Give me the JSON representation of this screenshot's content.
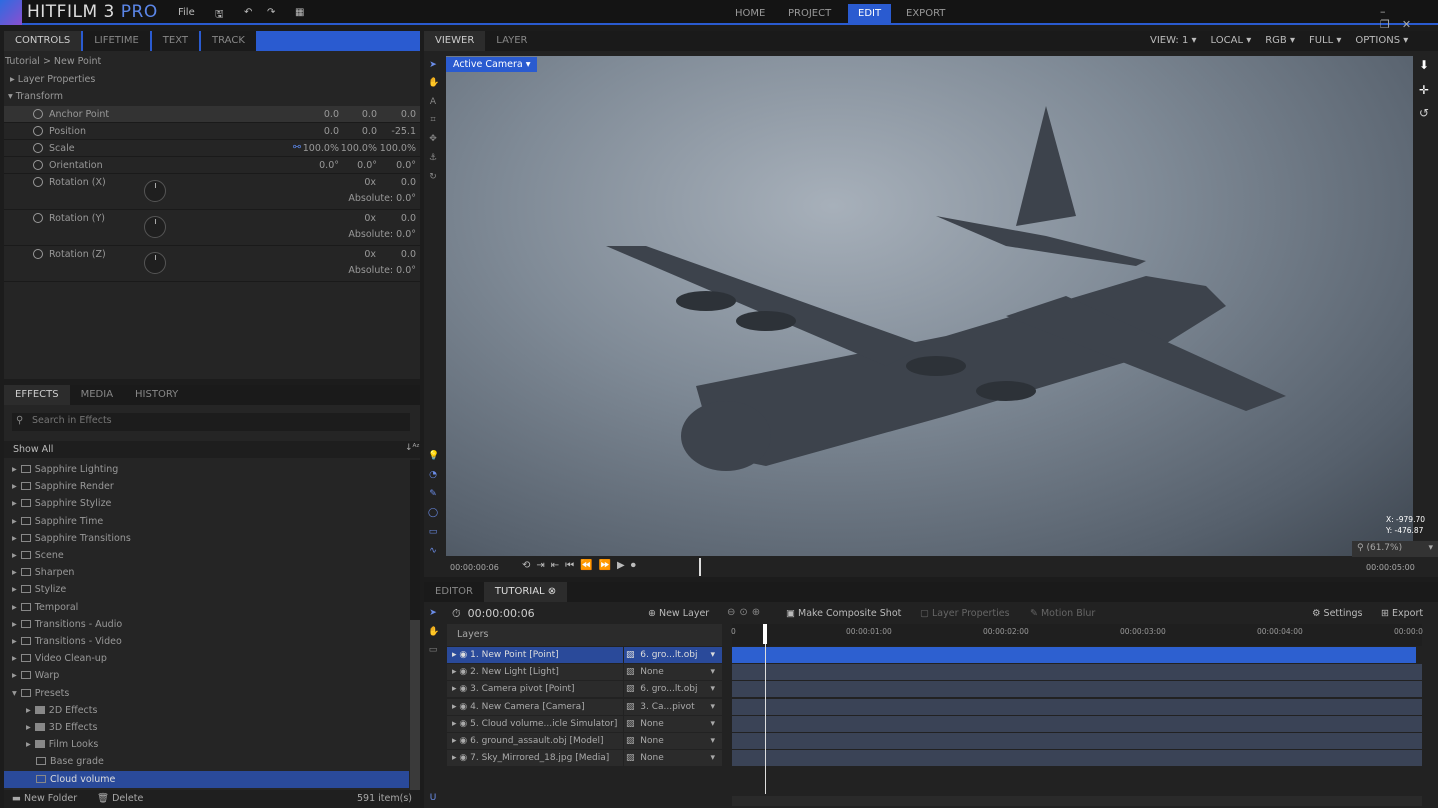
{
  "app": {
    "name": "HITFILM 3",
    "edition": "PRO",
    "menu_file": "File",
    "nav": [
      "HOME",
      "PROJECT",
      "EDIT",
      "EXPORT"
    ],
    "active_nav": "EDIT",
    "accent": "#2a5bd0"
  },
  "controls": {
    "tabs": [
      "CONTROLS",
      "LIFETIME",
      "TEXT",
      "TRACK"
    ],
    "breadcrumb": "Tutorial > New Point",
    "groups": [
      "Layer Properties",
      "Transform"
    ],
    "props": [
      {
        "name": "Anchor Point",
        "values": [
          "0.0",
          "0.0",
          "0.0"
        ]
      },
      {
        "name": "Position",
        "values": [
          "0.0",
          "0.0",
          "-25.1"
        ]
      },
      {
        "name": "Scale",
        "values": [
          "100.0%",
          "100.0%",
          "100.0%"
        ]
      },
      {
        "name": "Orientation",
        "values": [
          "0.0°",
          "0.0°",
          "0.0°"
        ]
      },
      {
        "name": "Rotation (X)",
        "values": [
          "0x",
          "0.0"
        ],
        "absolute": "Absolute: 0.0°"
      },
      {
        "name": "Rotation (Y)",
        "values": [
          "0x",
          "0.0"
        ],
        "absolute": "Absolute: 0.0°"
      },
      {
        "name": "Rotation (Z)",
        "values": [
          "0x",
          "0.0"
        ],
        "absolute": "Absolute: 0.0°"
      }
    ]
  },
  "effects": {
    "tabs": [
      "EFFECTS",
      "MEDIA",
      "HISTORY"
    ],
    "search_placeholder": "Search in Effects",
    "filter": "Show All",
    "items": [
      "Sapphire Lighting",
      "Sapphire Render",
      "Sapphire Stylize",
      "Sapphire Time",
      "Sapphire Transitions",
      "Scene",
      "Sharpen",
      "Stylize",
      "Temporal",
      "Transitions - Audio",
      "Transitions - Video",
      "Video Clean-up",
      "Warp",
      "Presets"
    ],
    "presets": [
      "2D Effects",
      "3D Effects",
      "Film Looks",
      "Base grade",
      "Cloud volume"
    ],
    "selected": "Cloud volume",
    "new_folder": "New Folder",
    "delete": "Delete",
    "count": "591 item(s)"
  },
  "viewer": {
    "tabs": [
      "VIEWER",
      "LAYER"
    ],
    "options": [
      "VIEW: 1",
      "LOCAL",
      "RGB",
      "FULL",
      "OPTIONS"
    ],
    "camera": "Active Camera",
    "coord_x": "X: -979.70",
    "coord_y": "Y: -476.87",
    "zoom": "(61.7%)",
    "time_start": "00:00:00:06",
    "time_end": "00:00:05:00"
  },
  "timeline": {
    "tabs": [
      "EDITOR",
      "TUTORIAL"
    ],
    "current_time": "00:00:00:06",
    "new_layer": "New Layer",
    "make_composite": "Make Composite Shot",
    "layer_properties": "Layer Properties",
    "motion_blur": "Motion Blur",
    "settings": "Settings",
    "export": "Export",
    "layers_header": "Layers",
    "ruler": [
      "0",
      "00:00:01:00",
      "00:00:02:00",
      "00:00:03:00",
      "00:00:04:00",
      "00:00:0"
    ],
    "layers": [
      {
        "name": "1. New Point [Point]",
        "parent": "6. gro...lt.obj"
      },
      {
        "name": "2. New Light [Light]",
        "parent": "None"
      },
      {
        "name": "3. Camera pivot [Point]",
        "parent": "6. gro...lt.obj"
      },
      {
        "name": "4. New Camera [Camera]",
        "parent": "3. Ca...pivot"
      },
      {
        "name": "5. Cloud volume...icle Simulator]",
        "parent": "None"
      },
      {
        "name": "6. ground_assault.obj [Model]",
        "parent": "None"
      },
      {
        "name": "7. Sky_Mirrored_18.jpg [Media]",
        "parent": "None"
      }
    ]
  }
}
